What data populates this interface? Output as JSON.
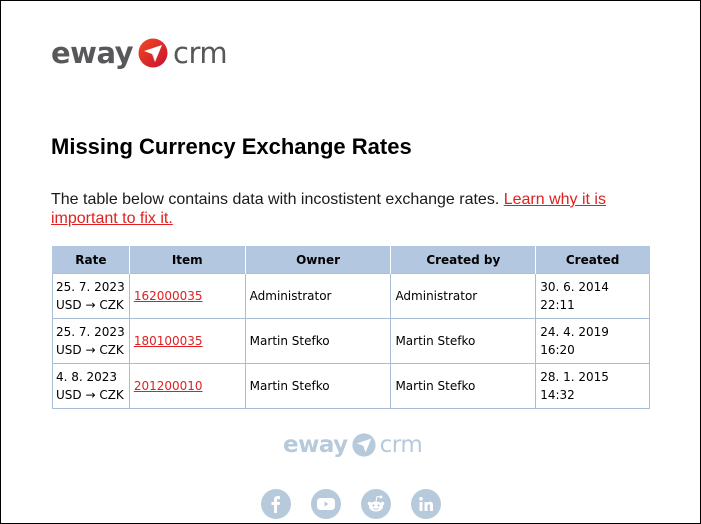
{
  "brand": {
    "name_left": "eway",
    "name_right": "crm",
    "accent_color": "#e02020",
    "header_bg_color": "#b4c7e0",
    "footer_tint_color": "#b7cadc"
  },
  "page": {
    "title": "Missing Currency Exchange Rates",
    "intro_text": "The table below contains data with incostistent exchange rates. ",
    "learn_link_text": "Learn why it is important to fix it."
  },
  "table": {
    "columns": [
      "Rate",
      "Item",
      "Owner",
      "Created by",
      "Created"
    ],
    "rows": [
      {
        "rate_date": "25. 7. 2023",
        "rate_pair": "USD → CZK",
        "item": "162000035",
        "owner": "Administrator",
        "created_by": "Administrator",
        "created": "30. 6. 2014 22:11"
      },
      {
        "rate_date": "25. 7. 2023",
        "rate_pair": "USD → CZK",
        "item": "180100035",
        "owner": "Martin Stefko",
        "created_by": "Martin Stefko",
        "created": "24. 4. 2019 16:20"
      },
      {
        "rate_date": "4. 8. 2023",
        "rate_pair": "USD → CZK",
        "item": "201200010",
        "owner": "Martin Stefko",
        "created_by": "Martin Stefko",
        "created": "28. 1. 2015 14:32"
      }
    ]
  },
  "footer": {
    "social": [
      {
        "name": "facebook",
        "icon": "facebook-icon"
      },
      {
        "name": "youtube",
        "icon": "youtube-icon"
      },
      {
        "name": "reddit",
        "icon": "reddit-icon"
      },
      {
        "name": "linkedin",
        "icon": "linkedin-icon"
      }
    ]
  }
}
